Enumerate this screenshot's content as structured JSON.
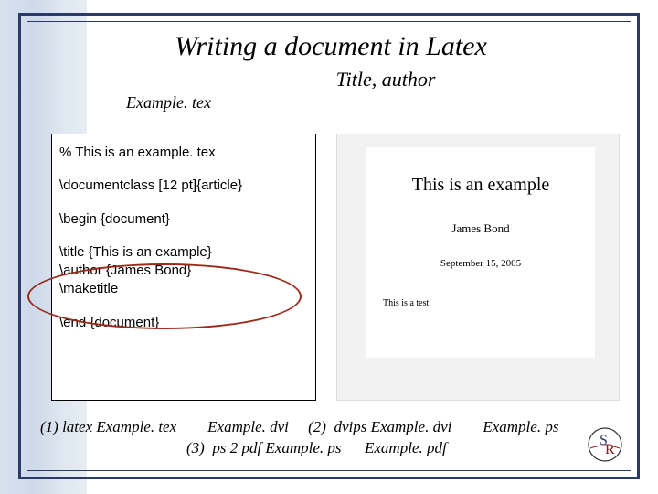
{
  "slide": {
    "title": "Writing a document in Latex",
    "subtitle": "Title, author",
    "source_label": "Example. tex"
  },
  "code": {
    "comment": "% This is an example. tex",
    "docclass": "\\documentclass [12 pt]{article}",
    "begin": "\\begin {document}",
    "titlecmd": "\\title {This is an example}",
    "authorcmd": "\\author {James Bond}",
    "maketitle": "\\maketitle",
    "end": "\\end {document}"
  },
  "preview": {
    "title": "This is an example",
    "author": "James Bond",
    "date": "September 15, 2005",
    "body": "This is a test"
  },
  "pipeline": {
    "row1": "(1) latex Example. tex        Example. dvi     (2)  dvips Example. dvi        Example. ps",
    "row2": "(3)  ps 2 pdf Example. ps      Example. pdf"
  },
  "logo": {
    "letters": "SR"
  }
}
